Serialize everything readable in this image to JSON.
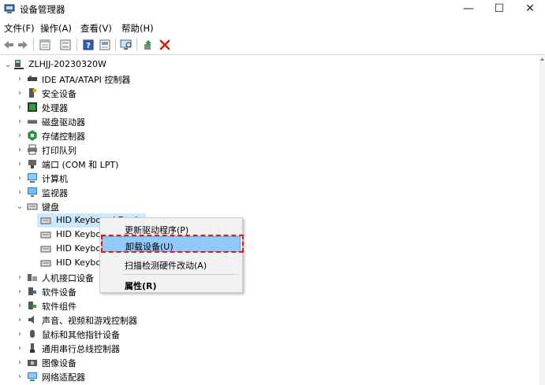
{
  "window": {
    "title": "设备管理器",
    "minimize": "—",
    "maximize": "☐",
    "close": "✕"
  },
  "menubar": [
    "文件(F)",
    "操作(A)",
    "查看(V)",
    "帮助(H)"
  ],
  "toolbar": {
    "buttons": [
      "back-icon",
      "forward-icon",
      "properties-pane-icon",
      "device-list-icon",
      "help-icon",
      "show-hidden-icon",
      "scan-hardware-icon",
      "update-driver-icon",
      "uninstall-icon"
    ]
  },
  "tree": {
    "root": "ZLHJJ-20230320W",
    "categories": [
      "IDE ATA/ATAPI 控制器",
      "安全设备",
      "处理器",
      "磁盘驱动器",
      "存储控制器",
      "打印队列",
      "端口 (COM 和 LPT)",
      "计算机",
      "监视器",
      "键盘",
      "HID Keyboard Device",
      "HID Keyboard Device",
      "HID Keyboard Device",
      "HID Keyboard Device",
      "人机接口设备",
      "软件设备",
      "软件组件",
      "声音、视频和游戏控制器",
      "鼠标和其他指针设备",
      "通用串行总线控制器",
      "图像设备",
      "网络适配器"
    ],
    "keyboard_children_visible": [
      "HID Keyboard Devi",
      "HID Keybo",
      "HID Keybo",
      "HID Keybo"
    ]
  },
  "context_menu": {
    "items": [
      "更新驱动程序(P)",
      "卸载设备(U)",
      "扫描检测硬件改动(A)",
      "属性(R)"
    ],
    "highlighted_index": 1
  },
  "colors": {
    "highlight": "#91c9f7",
    "annotation_red": "#e4161b",
    "uninstall_red": "#d81e06"
  }
}
